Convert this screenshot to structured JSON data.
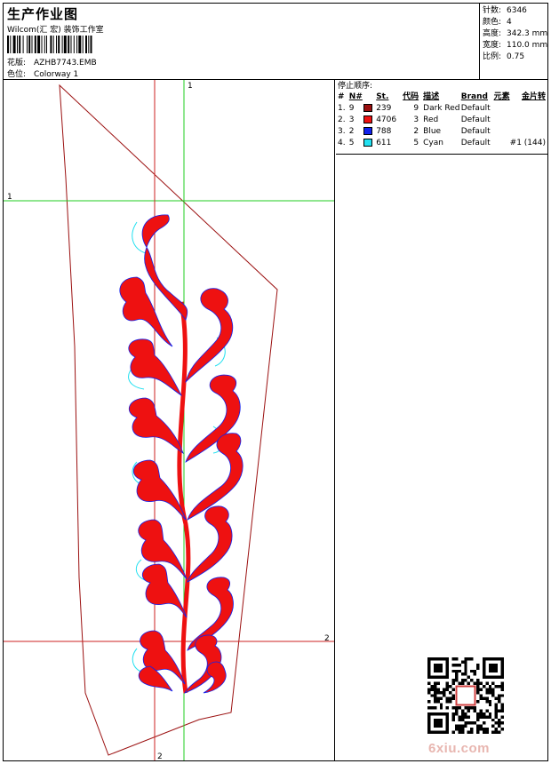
{
  "header": {
    "title": "生产作业图",
    "company": "Wilcom(汇 宏) 装饰工作室",
    "design_label": "花版:",
    "design_name": "AZHB7743.EMB",
    "colorway_label": "色位:",
    "colorway_name": "Colorway 1"
  },
  "stats": [
    {
      "label": "针数:",
      "value": "6346"
    },
    {
      "label": "颜色:",
      "value": "4"
    },
    {
      "label": "高度:",
      "value": "342.3 mm"
    },
    {
      "label": "宽度:",
      "value": "110.0 mm"
    },
    {
      "label": "比例:",
      "value": "0.75"
    }
  ],
  "stop_sequence": {
    "title": "停止顺序:",
    "columns": [
      "#",
      "N#",
      "St.",
      "代码",
      "描述",
      "Brand",
      "元素",
      "金片转"
    ],
    "rows": [
      {
        "idx": "1.",
        "n": "9",
        "color": "#9b1010",
        "st": "239",
        "code": "9",
        "desc": "Dark Red",
        "brand": "Default",
        "elem": "",
        "sequin": ""
      },
      {
        "idx": "2.",
        "n": "3",
        "color": "#ee1111",
        "st": "4706",
        "code": "3",
        "desc": "Red",
        "brand": "Default",
        "elem": "",
        "sequin": ""
      },
      {
        "idx": "3.",
        "n": "2",
        "color": "#1122ee",
        "st": "788",
        "code": "2",
        "desc": "Blue",
        "brand": "Default",
        "elem": "",
        "sequin": ""
      },
      {
        "idx": "4.",
        "n": "5",
        "color": "#22e0f0",
        "st": "611",
        "code": "5",
        "desc": "Cyan",
        "brand": "Default",
        "elem": "",
        "sequin": "#1 (144)"
      }
    ]
  },
  "guides": {
    "top_label": "1",
    "left_label": "1",
    "right_label": "2",
    "bottom_label": "2"
  },
  "colors": {
    "outline": "#9b1010",
    "fill": "#ee1111",
    "guide_green": "#22cc22",
    "guide_red": "#cc2222",
    "underlay_blue": "#1122ee",
    "cyan": "#22e0f0"
  },
  "watermark": "6xiu.com"
}
